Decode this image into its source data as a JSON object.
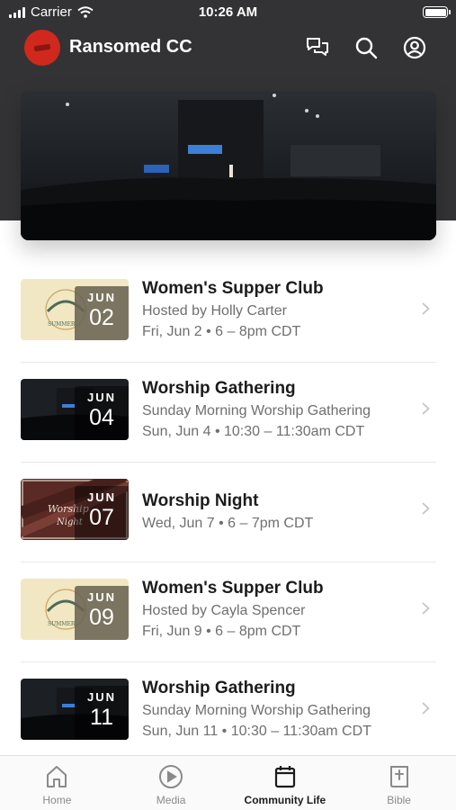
{
  "status_bar": {
    "carrier": "Carrier",
    "time": "10:26 AM"
  },
  "header": {
    "title": "Ransomed CC",
    "icons": [
      "chat-icon",
      "search-icon",
      "account-icon"
    ]
  },
  "hero": {
    "image": "church-auditorium-photo"
  },
  "events": [
    {
      "title": "Women's Supper Club",
      "lines": [
        "Hosted by Holly Carter",
        "Fri, Jun 2 • 6 – 8pm CDT"
      ],
      "month": "JUN",
      "day": "02",
      "thumb": "supper"
    },
    {
      "title": "Worship Gathering",
      "lines": [
        "Sunday Morning Worship Gathering",
        "Sun, Jun 4 • 10:30 – 11:30am CDT"
      ],
      "month": "JUN",
      "day": "04",
      "thumb": "gathering"
    },
    {
      "title": "Worship Night",
      "lines": [
        "Wed, Jun 7 • 6 – 7pm CDT"
      ],
      "month": "JUN",
      "day": "07",
      "thumb": "night"
    },
    {
      "title": "Women's Supper Club",
      "lines": [
        "Hosted by Cayla Spencer",
        "Fri, Jun 9 • 6 – 8pm CDT"
      ],
      "month": "JUN",
      "day": "09",
      "thumb": "supper"
    },
    {
      "title": "Worship Gathering",
      "lines": [
        "Sunday Morning Worship Gathering",
        "Sun, Jun 11 • 10:30 – 11:30am CDT"
      ],
      "month": "JUN",
      "day": "11",
      "thumb": "gathering"
    }
  ],
  "tabs": [
    {
      "label": "Home",
      "icon": "home-icon",
      "active": false
    },
    {
      "label": "Media",
      "icon": "play-icon",
      "active": false
    },
    {
      "label": "Community Life",
      "icon": "calendar-icon",
      "active": true
    },
    {
      "label": "Bible",
      "icon": "bible-icon",
      "active": false
    }
  ],
  "colors": {
    "header_bg": "#333335",
    "brand_red": "#d0281c",
    "active_tab": "#1c1c1c",
    "inactive_tab": "#8a8a8a"
  }
}
